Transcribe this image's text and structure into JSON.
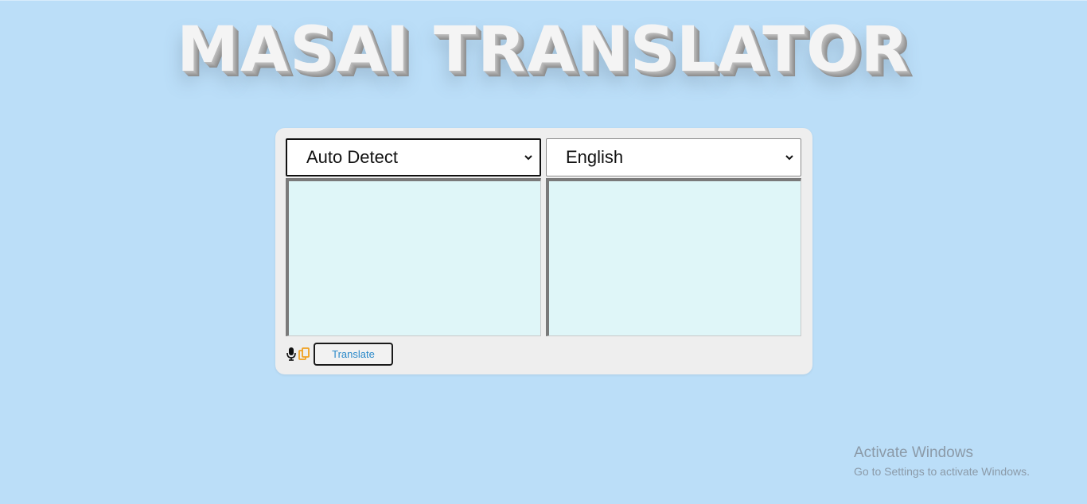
{
  "header": {
    "title": "MASAI TRANSLATOR"
  },
  "translator": {
    "source_language": "Auto Detect",
    "target_language": "English",
    "source_text": "",
    "target_text": "",
    "translate_label": "Translate",
    "icons": {
      "mic": "microphone-icon",
      "copy": "copy-icon"
    }
  },
  "watermark": {
    "line1": "Activate Windows",
    "line2": "Go to Settings to activate Windows."
  },
  "colors": {
    "background": "#bbdef8",
    "panel": "#eeeeee",
    "textarea": "#dff6f8",
    "copy_icon": "#f0a020",
    "translate_text": "#2a89c9"
  }
}
